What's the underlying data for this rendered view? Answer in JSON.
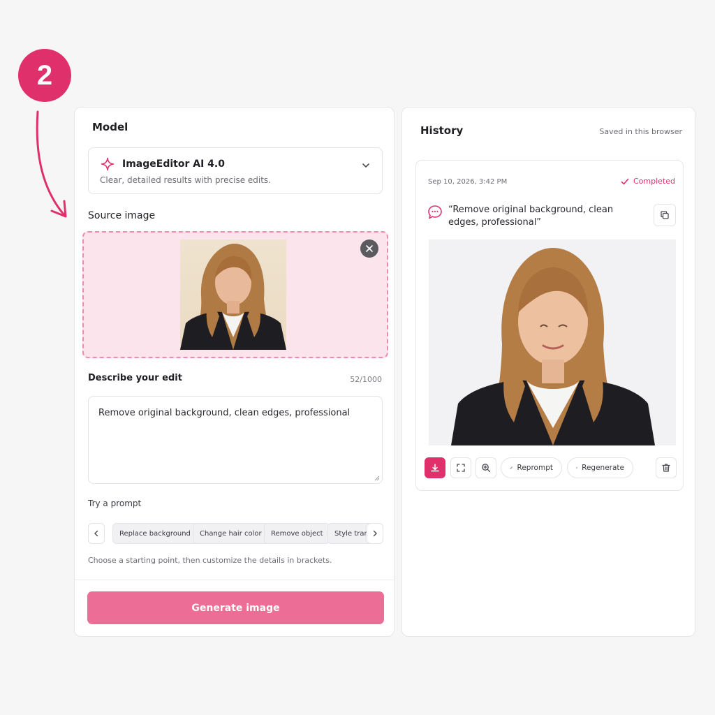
{
  "step": {
    "number": "2"
  },
  "editor": {
    "model_heading": "Model",
    "model": {
      "name": "ImageEditor AI 4.0",
      "description": "Clear, detailed results with precise edits."
    },
    "source_heading": "Source image",
    "describe_heading": "Describe your edit",
    "char_count": "52/1000",
    "prompt_value": "Remove original background,  clean edges, professional",
    "try_label": "Try a prompt",
    "chips": [
      "Replace background",
      "Change hair color",
      "Remove object",
      "Style transf"
    ],
    "hint": "Choose a starting point, then customize the details in brackets.",
    "generate_label": "Generate image"
  },
  "history": {
    "heading": "History",
    "saved_note": "Saved in this browser",
    "card": {
      "date": "Sep 10, 2026, 3:42 PM",
      "status": "Completed",
      "prompt": "“Remove original background,  clean edges, professional”"
    },
    "actions": {
      "reprompt": "Reprompt",
      "regenerate": "Regenerate"
    }
  },
  "colors": {
    "accent": "#e0306c",
    "generate_bg": "#ec6d95",
    "dropzone_bg": "#fbe4ec"
  },
  "icons": [
    "sparkle-icon",
    "chevron-down-icon",
    "close-icon",
    "chevron-left-icon",
    "chevron-right-icon",
    "check-icon",
    "chat-bubble-icon",
    "copy-icon",
    "download-icon",
    "fullscreen-icon",
    "zoom-in-icon",
    "pencil-icon",
    "refresh-icon",
    "trash-icon"
  ]
}
